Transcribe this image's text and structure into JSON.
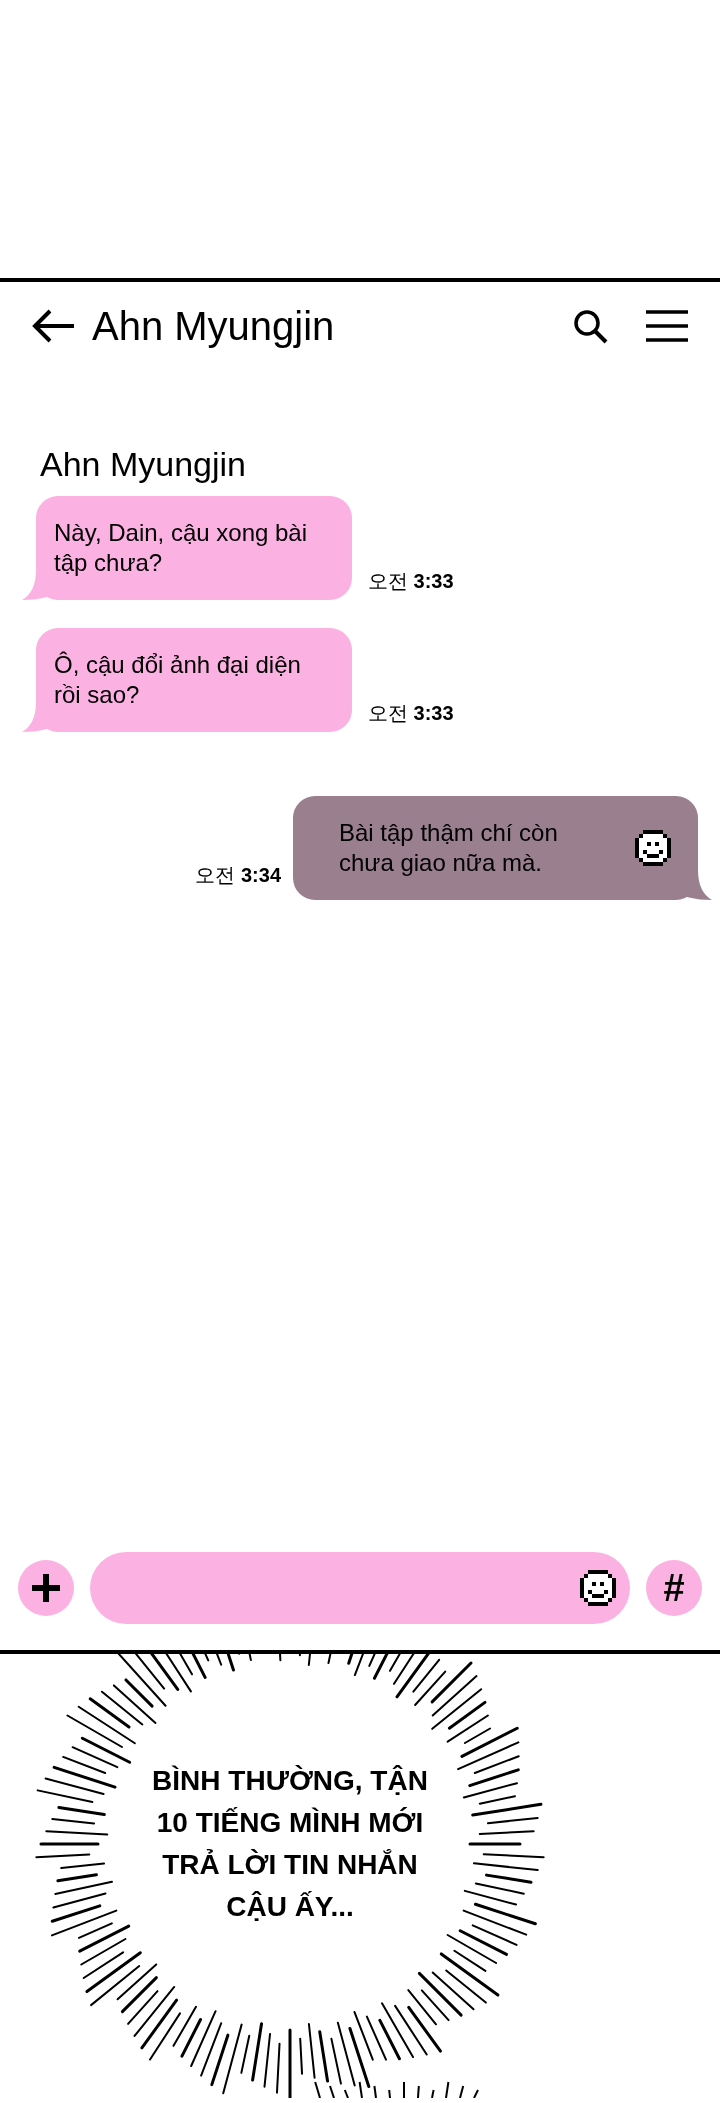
{
  "header": {
    "title": "Ahn Myungjin"
  },
  "sender": "Ahn Myungjin",
  "messages": [
    {
      "kind": "received",
      "text": "Này, Dain, cậu xong bài tập chưa?",
      "time": "오전 **3:33**"
    },
    {
      "kind": "received",
      "text": "Ô, cậu đổi ảnh đại diện rồi sao?",
      "time": "오전 **3:33**"
    },
    {
      "kind": "sent",
      "text": "Bài tập thậm chí còn chưa giao nữa mà.",
      "time": "오전 **3:34**",
      "sticker": true
    }
  ],
  "composer": {
    "hash": "#"
  },
  "caption": [
    "BÌNH THƯỜNG, TẬN",
    "10 TIẾNG MÌNH MỚI",
    "TRẢ LỜI TIN NHẮN",
    "CẬU ẤY..."
  ]
}
